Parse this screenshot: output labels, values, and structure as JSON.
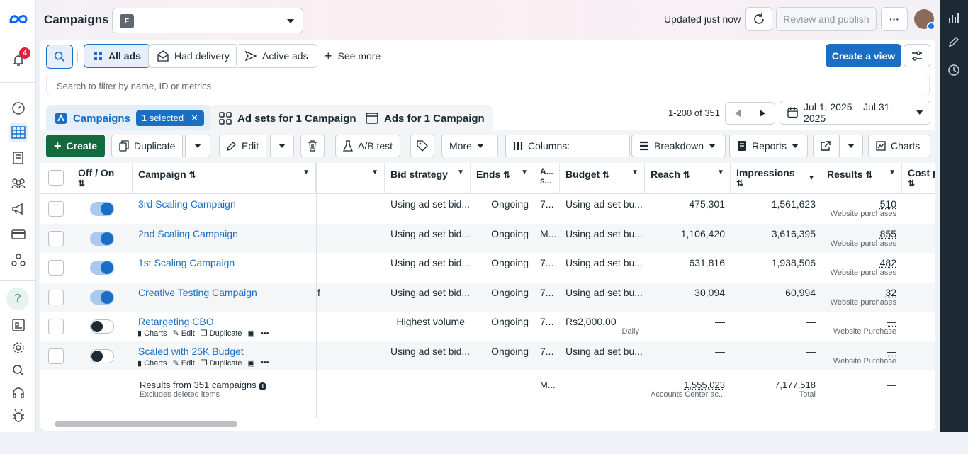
{
  "header": {
    "title": "Campaigns",
    "account_initial": "F",
    "updated": "Updated just now",
    "review_publish": "Review and publish",
    "more": "···"
  },
  "notifications": {
    "count": "4"
  },
  "views": {
    "all_ads": "All ads",
    "had_delivery": "Had delivery",
    "active_ads": "Active ads",
    "see_more": "See more",
    "create_view": "Create a view"
  },
  "filter": {
    "placeholder": "Search to filter by name, ID or metrics"
  },
  "tabs": {
    "campaigns": "Campaigns",
    "selected": "1 selected",
    "ad_sets": "Ad sets for 1 Campaign",
    "ads": "Ads for 1 Campaign"
  },
  "pagination": {
    "range": "1-200 of 351"
  },
  "date_range": "Jul 1, 2025 – Jul 31, 2025",
  "toolbar": {
    "create": "Create",
    "duplicate": "Duplicate",
    "edit": "Edit",
    "ab_test": "A/B test",
    "more": "More",
    "columns": "Columns:",
    "breakdown": "Breakdown",
    "reports": "Reports",
    "charts": "Charts"
  },
  "table": {
    "headers": {
      "off_on": "Off / On",
      "campaign": "Campaign",
      "bid_strategy": "Bid strategy",
      "ends": "Ends",
      "attr": "A... s...",
      "budget": "Budget",
      "reach": "Reach",
      "impressions": "Impressions",
      "results": "Results",
      "cost": "Cost p"
    },
    "rows": [
      {
        "name": "3rd Scaling Campaign",
        "on": true,
        "hidden": "",
        "bid": "Using ad set bid...",
        "ends": "Ongoing",
        "attr": "7...",
        "budget": "Using ad set bu...",
        "budget_sub": "",
        "reach": "475,301",
        "impressions": "1,561,623",
        "results": "510",
        "results_sub": "Website purchases",
        "actions": false
      },
      {
        "name": "2nd Scaling Campaign",
        "on": true,
        "hidden": "",
        "bid": "Using ad set bid...",
        "ends": "Ongoing",
        "attr": "M...",
        "budget": "Using ad set bu...",
        "budget_sub": "",
        "reach": "1,106,420",
        "impressions": "3,616,395",
        "results": "855",
        "results_sub": "Website purchases",
        "actions": false
      },
      {
        "name": "1st Scaling Campaign",
        "on": true,
        "hidden": "",
        "bid": "Using ad set bid...",
        "ends": "Ongoing",
        "attr": "7...",
        "budget": "Using ad set bu...",
        "budget_sub": "",
        "reach": "631,816",
        "impressions": "1,938,506",
        "results": "482",
        "results_sub": "Website purchases",
        "actions": false
      },
      {
        "name": "Creative Testing Campaign",
        "on": true,
        "hidden": "f",
        "bid": "Using ad set bid...",
        "ends": "Ongoing",
        "attr": "7...",
        "budget": "Using ad set bu...",
        "budget_sub": "",
        "reach": "30,094",
        "impressions": "60,994",
        "results": "32",
        "results_sub": "Website purchases",
        "actions": false
      },
      {
        "name": "Retargeting CBO",
        "on": false,
        "hidden": "",
        "bid": "Highest volume",
        "ends": "Ongoing",
        "attr": "7...",
        "budget": "Rs2,000.00",
        "budget_sub": "Daily",
        "reach": "—",
        "impressions": "—",
        "results": "—",
        "results_sub": "Website Purchase",
        "actions": true
      },
      {
        "name": "Scaled with 25K Budget",
        "on": false,
        "hidden": "",
        "bid": "Using ad set bid...",
        "ends": "Ongoing",
        "attr": "7...",
        "budget": "Using ad set bu...",
        "budget_sub": "",
        "reach": "—",
        "impressions": "—",
        "results": "—",
        "results_sub": "Website Purchase",
        "actions": true
      }
    ],
    "row_actions": {
      "charts": "Charts",
      "edit": "Edit",
      "duplicate": "Duplicate",
      "more": "•••"
    },
    "summary": {
      "label": "Results from 351 campaigns",
      "sub": "Excludes deleted items",
      "attr": "M...",
      "reach": "1,555,023",
      "reach_sub": "Accounts Center ac...",
      "impressions": "7,177,518",
      "impressions_sub": "Total",
      "results": "—"
    }
  }
}
